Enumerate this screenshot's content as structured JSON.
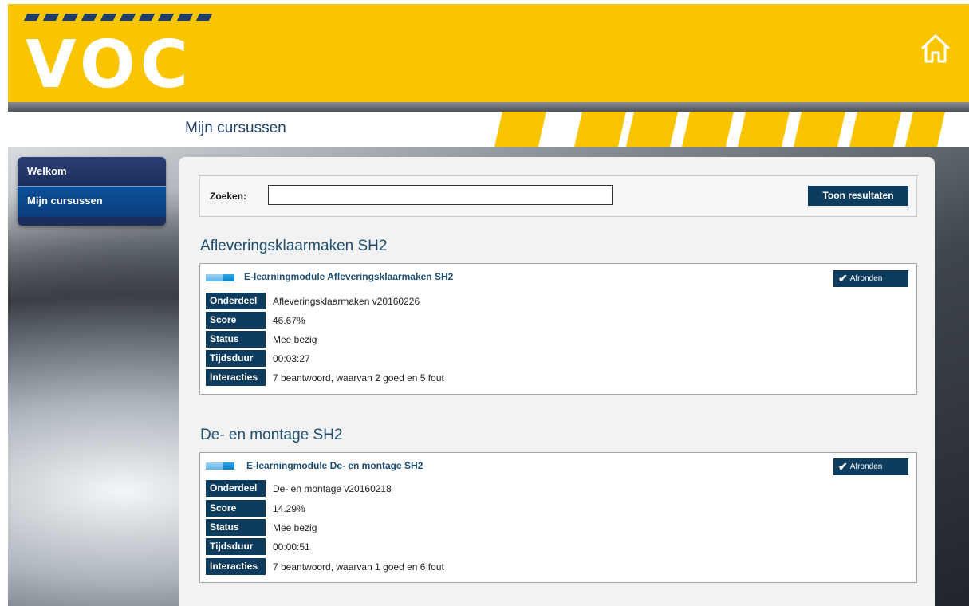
{
  "header": {
    "logo_text": "VOC",
    "home_icon": "home-icon"
  },
  "page_title": "Mijn cursussen",
  "sidebar": {
    "items": [
      {
        "label": "Welkom",
        "active": false
      },
      {
        "label": "Mijn cursussen",
        "active": true
      }
    ]
  },
  "search": {
    "label": "Zoeken:",
    "value": "",
    "button_label": "Toon resultaten"
  },
  "courses": [
    {
      "title": "Afleveringsklaarmaken SH2",
      "module": "E-learningmodule Afleveringsklaarmaken SH2",
      "action_label": "Afronden",
      "fields": [
        {
          "label": "Onderdeel",
          "value": "Afleveringsklaarmaken v20160226"
        },
        {
          "label": "Score",
          "value": "46.67%"
        },
        {
          "label": "Status",
          "value": "Mee bezig"
        },
        {
          "label": "Tijdsduur",
          "value": "00:03:27"
        },
        {
          "label": "Interacties",
          "value": "7 beantwoord, waarvan 2 goed en 5 fout"
        }
      ]
    },
    {
      "title": "De- en montage SH2",
      "module": "E-learningmodule De- en montage SH2",
      "action_label": "Afronden",
      "fields": [
        {
          "label": "Onderdeel",
          "value": "De- en montage v20160218"
        },
        {
          "label": "Score",
          "value": "14.29%"
        },
        {
          "label": "Status",
          "value": "Mee bezig"
        },
        {
          "label": "Tijdsduur",
          "value": "00:00:51"
        },
        {
          "label": "Interacties",
          "value": "7 beantwoord, waarvan 1 goed en 6 fout"
        }
      ]
    }
  ],
  "colors": {
    "brand_yellow": "#f9c400",
    "navy": "#0d3c5e",
    "title_blue": "#1f4d6d"
  }
}
